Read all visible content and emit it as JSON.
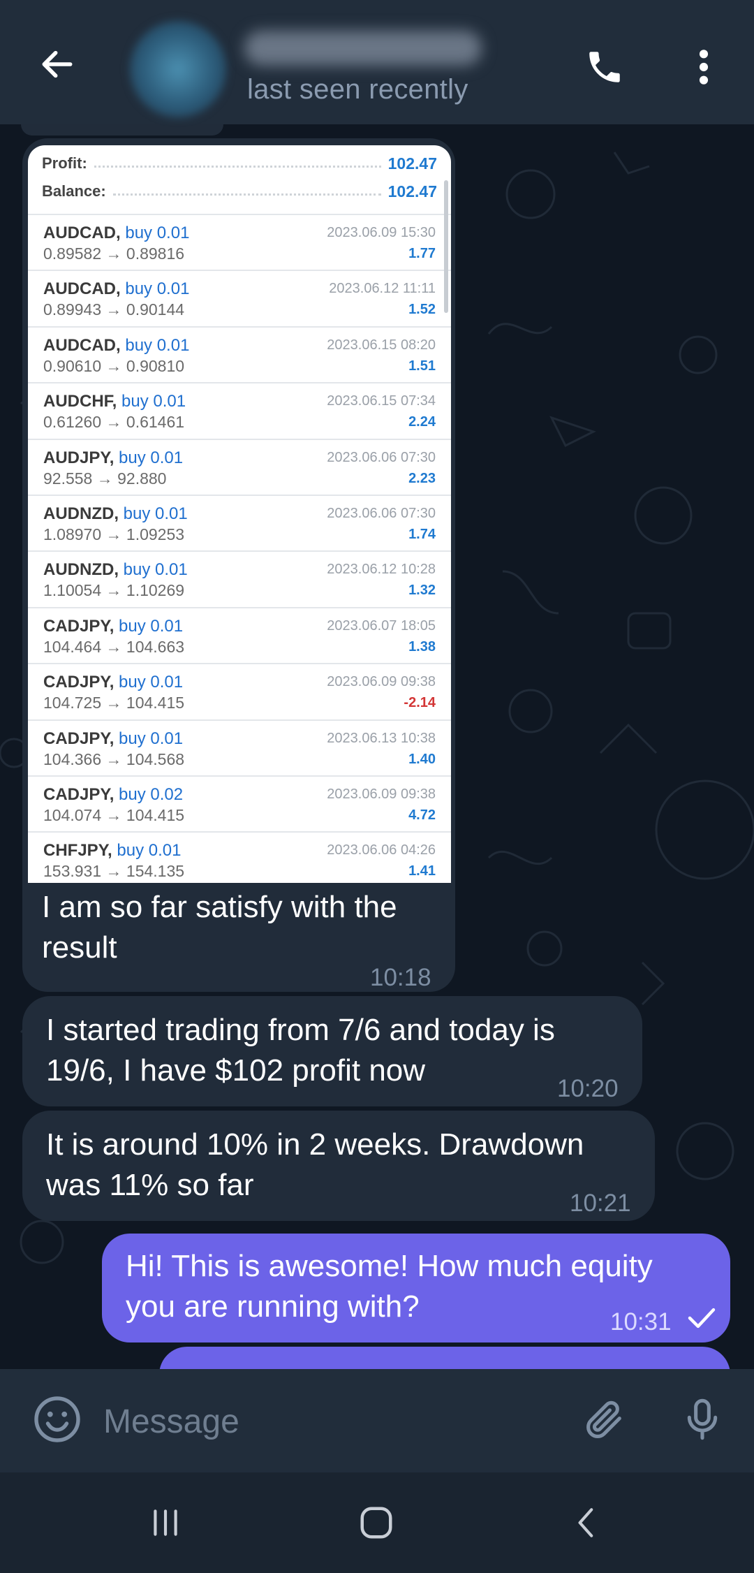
{
  "header": {
    "status": "last seen recently"
  },
  "photo": {
    "summary": [
      {
        "label": "Profit:",
        "value": "102.47"
      },
      {
        "label": "Balance:",
        "value": "102.47"
      }
    ],
    "trades": [
      {
        "symbol": "AUDCAD,",
        "direction": "buy 0.01",
        "prices": "0.89582 → 0.89816",
        "date": "2023.06.09 15:30",
        "profit": "1.77"
      },
      {
        "symbol": "AUDCAD,",
        "direction": "buy 0.01",
        "prices": "0.89943 → 0.90144",
        "date": "2023.06.12 11:11",
        "profit": "1.52"
      },
      {
        "symbol": "AUDCAD,",
        "direction": "buy 0.01",
        "prices": "0.90610 → 0.90810",
        "date": "2023.06.15 08:20",
        "profit": "1.51"
      },
      {
        "symbol": "AUDCHF,",
        "direction": "buy 0.01",
        "prices": "0.61260 → 0.61461",
        "date": "2023.06.15 07:34",
        "profit": "2.24"
      },
      {
        "symbol": "AUDJPY,",
        "direction": "buy 0.01",
        "prices": "92.558 → 92.880",
        "date": "2023.06.06 07:30",
        "profit": "2.23"
      },
      {
        "symbol": "AUDNZD,",
        "direction": "buy 0.01",
        "prices": "1.08970 → 1.09253",
        "date": "2023.06.06 07:30",
        "profit": "1.74"
      },
      {
        "symbol": "AUDNZD,",
        "direction": "buy 0.01",
        "prices": "1.10054 → 1.10269",
        "date": "2023.06.12 10:28",
        "profit": "1.32"
      },
      {
        "symbol": "CADJPY,",
        "direction": "buy 0.01",
        "prices": "104.464 → 104.663",
        "date": "2023.06.07 18:05",
        "profit": "1.38"
      },
      {
        "symbol": "CADJPY,",
        "direction": "buy 0.01",
        "prices": "104.725 → 104.415",
        "date": "2023.06.09 09:38",
        "profit": "-2.14"
      },
      {
        "symbol": "CADJPY,",
        "direction": "buy 0.01",
        "prices": "104.366 → 104.568",
        "date": "2023.06.13 10:38",
        "profit": "1.40"
      },
      {
        "symbol": "CADJPY,",
        "direction": "buy 0.02",
        "prices": "104.074 → 104.415",
        "date": "2023.06.09 09:38",
        "profit": "4.72"
      },
      {
        "symbol": "CHFJPY,",
        "direction": "buy 0.01",
        "prices": "153.931 → 154.135",
        "date": "2023.06.06 04:26",
        "profit": "1.41"
      }
    ],
    "caption_line1": "I am so far satisfy with the",
    "caption_line2": "result",
    "time": "10:18"
  },
  "messages": [
    {
      "line1": "I started trading from 7/6 and today is",
      "line2": "19/6, I have $102 profit now",
      "time": "10:20"
    },
    {
      "line1": "It is around 10% in 2 weeks. Drawdown",
      "line2": "was 11% so far",
      "time": "10:21"
    },
    {
      "line1": "Hi! This is awesome! How much equity",
      "line2": "you are running with?",
      "time": "10:31"
    }
  ],
  "input": {
    "placeholder": "Message"
  },
  "colors": {
    "header_bg": "#212d3b",
    "chat_bg": "#0f1722",
    "incoming_bubble": "#212c3a",
    "outgoing_bubble": "#6c63e8",
    "profit_blue": "#1f7ad0",
    "loss_red": "#d33636"
  },
  "icons": [
    "back-arrow-icon",
    "phone-icon",
    "more-vertical-icon",
    "emoji-icon",
    "paperclip-icon",
    "microphone-icon",
    "recents-icon",
    "home-icon",
    "nav-back-icon",
    "check-icon"
  ]
}
